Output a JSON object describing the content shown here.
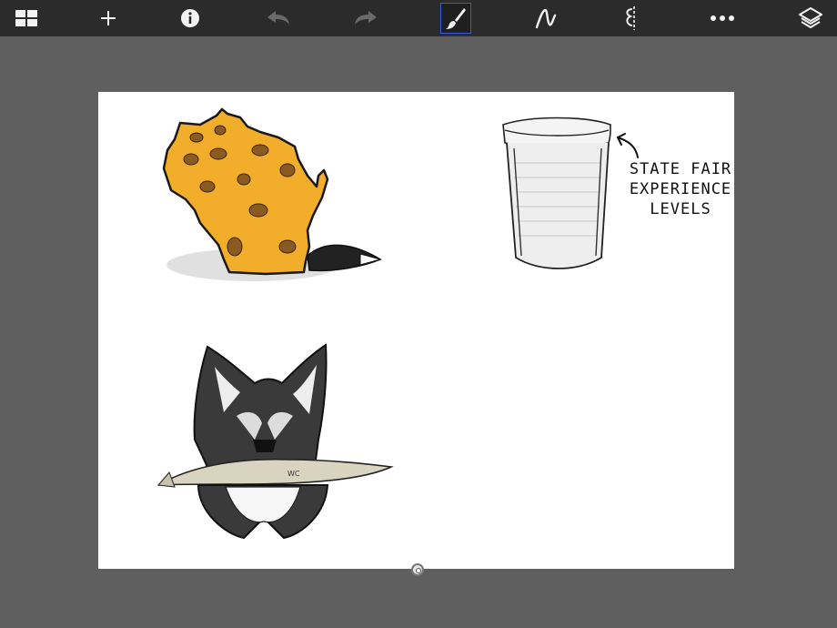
{
  "toolbar": {
    "buttons": [
      {
        "name": "gallery-grid-icon",
        "active": false,
        "enabled": true
      },
      {
        "name": "plus-icon",
        "active": false,
        "enabled": true
      },
      {
        "name": "info-icon",
        "active": false,
        "enabled": true
      },
      {
        "name": "undo-icon",
        "active": false,
        "enabled": false
      },
      {
        "name": "redo-icon",
        "active": false,
        "enabled": false
      },
      {
        "name": "brush-icon",
        "active": true,
        "enabled": true
      },
      {
        "name": "stroke-icon",
        "active": false,
        "enabled": true
      },
      {
        "name": "symmetry-icon",
        "active": false,
        "enabled": true
      },
      {
        "name": "more-icon",
        "active": false,
        "enabled": true
      },
      {
        "name": "layers-icon",
        "active": false,
        "enabled": true
      }
    ],
    "active_color": "#3d5ad8"
  },
  "canvas": {
    "annotation_lines": [
      "STATE FAIR",
      "EXPERIENCE",
      "LEVELS"
    ],
    "drawings": [
      "wisconsin-cheese-drawing",
      "cup-drawing",
      "fox-with-fish-drawing"
    ],
    "fish_signature": "WC"
  }
}
